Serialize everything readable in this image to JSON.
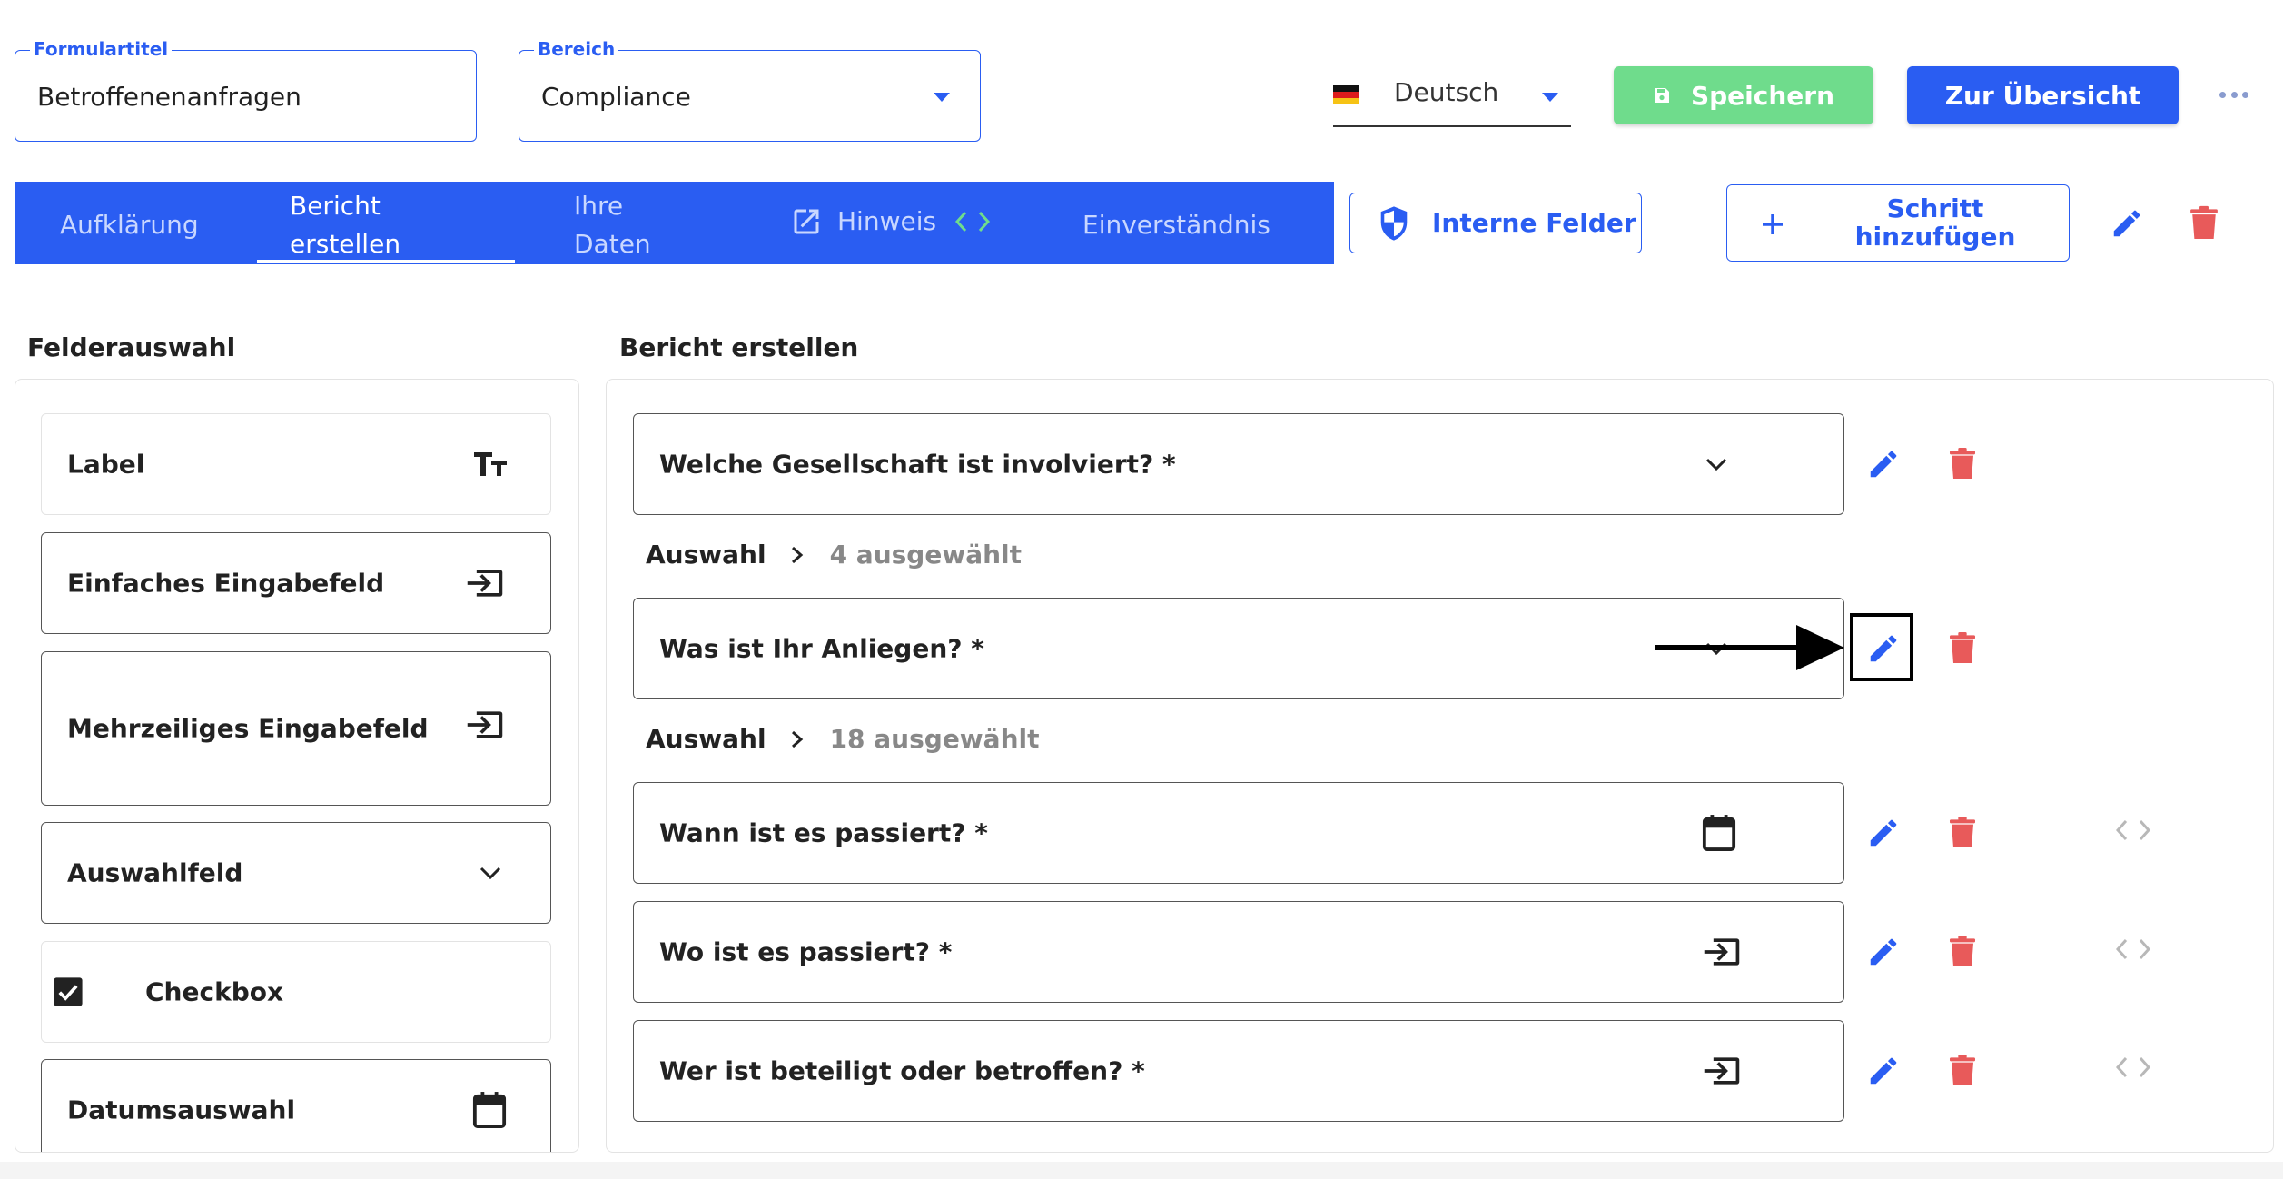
{
  "header": {
    "form_title": {
      "legend": "Formulartitel",
      "value": "Betroffenenanfragen"
    },
    "area": {
      "legend": "Bereich",
      "value": "Compliance"
    },
    "language": {
      "value": "Deutsch",
      "flag": "de-flag"
    },
    "save_label": "Speichern",
    "overview_label": "Zur Übersicht",
    "more_icon": "more-horizontal-icon"
  },
  "tabs": [
    {
      "label": "Aufklärung"
    },
    {
      "label": "Bericht erstellen",
      "line1": "Bericht",
      "line2": "erstellen",
      "active": true
    },
    {
      "label": "Ihre Daten",
      "line1": "Ihre",
      "line2": "Daten"
    },
    {
      "label": "Hinweis"
    },
    {
      "label": "Einverständnis"
    }
  ],
  "toolbar": {
    "internal_fields_label": "Interne Felder",
    "add_step_line1": "Schritt",
    "add_step_line2": "hinzufügen"
  },
  "field_selection": {
    "title": "Felderauswahl",
    "items": [
      {
        "label": "Label",
        "icon": "text-size-icon"
      },
      {
        "label": "Einfaches Eingabefeld",
        "icon": "input-field-icon"
      },
      {
        "label": "Mehrzeiliges Eingabefeld",
        "icon": "input-field-icon"
      },
      {
        "label": "Auswahlfeld",
        "icon": "chevron-down-icon"
      },
      {
        "label": "Checkbox",
        "icon": "checkbox-checked-icon"
      },
      {
        "label": "Datumsauswahl",
        "icon": "calendar-icon"
      }
    ]
  },
  "report": {
    "title": "Bericht erstellen",
    "fields": [
      {
        "label": "Welche Gesellschaft ist involviert? *",
        "icon": "chevron-down-icon"
      },
      {
        "label": "Was ist Ihr Anliegen? *",
        "icon": "chevron-down-icon"
      },
      {
        "label": "Wann ist es passiert? *",
        "icon": "calendar-icon"
      },
      {
        "label": "Wo ist es passiert? *",
        "icon": "input-field-icon"
      },
      {
        "label": "Wer ist beteiligt oder betroffen? *",
        "icon": "input-field-icon"
      }
    ],
    "selections": [
      {
        "label": "Auswahl",
        "count": "4 ausgewählt"
      },
      {
        "label": "Auswahl",
        "count": "18 ausgewählt"
      }
    ]
  },
  "colors": {
    "primary": "#2a5df2",
    "save_green": "#6fdc8c",
    "delete_red": "#e85a5a",
    "muted": "#888888"
  }
}
